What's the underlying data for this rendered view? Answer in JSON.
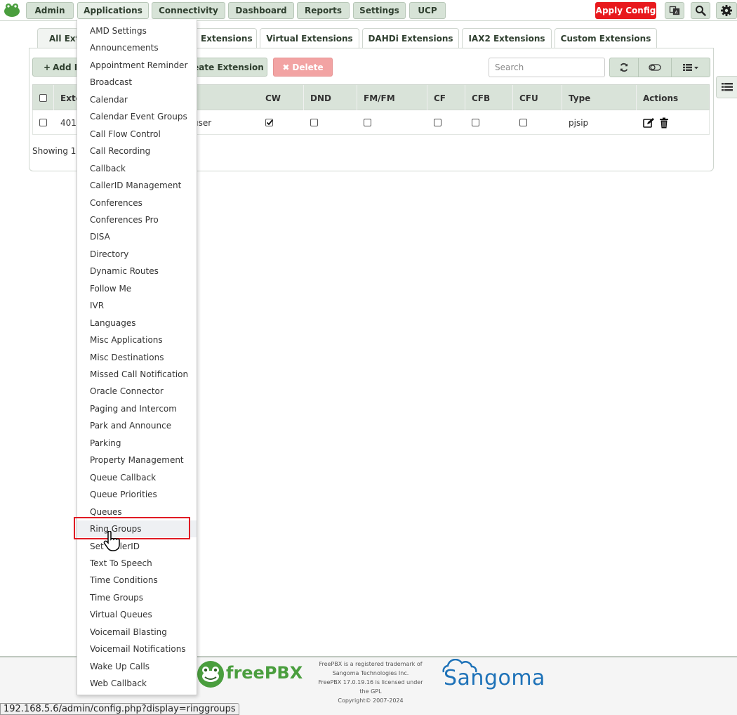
{
  "nav": {
    "items": [
      {
        "label": "Admin"
      },
      {
        "label": "Applications"
      },
      {
        "label": "Connectivity"
      },
      {
        "label": "Dashboard"
      },
      {
        "label": "Reports"
      },
      {
        "label": "Settings"
      },
      {
        "label": "UCP"
      }
    ],
    "apply_label": "Apply Config"
  },
  "tabs": [
    {
      "label": "All Exte"
    },
    {
      "label": "] Extensions"
    },
    {
      "label": "Virtual Extensions"
    },
    {
      "label": "DAHDi Extensions"
    },
    {
      "label": "IAX2 Extensions"
    },
    {
      "label": "Custom Extensions"
    }
  ],
  "toolbar": {
    "add_label": "Add E",
    "create_label": "eate Extension",
    "delete_label": "Delete",
    "search_placeholder": "Search"
  },
  "table": {
    "headers": [
      "Exte",
      "CW",
      "DND",
      "FM/FM",
      "CF",
      "CFB",
      "CFU",
      "Type",
      "Actions"
    ],
    "row": {
      "ext": "401",
      "name": "user",
      "type": "pjsip",
      "cw_checked": true
    },
    "showing": "Showing 1 t"
  },
  "dropdown": {
    "items": [
      "AMD Settings",
      "Announcements",
      "Appointment Reminder",
      "Broadcast",
      "Calendar",
      "Calendar Event Groups",
      "Call Flow Control",
      "Call Recording",
      "Callback",
      "CallerID Management",
      "Conferences",
      "Conferences Pro",
      "DISA",
      "Directory",
      "Dynamic Routes",
      "Follow Me",
      "IVR",
      "Languages",
      "Misc Applications",
      "Misc Destinations",
      "Missed Call Notification",
      "Oracle Connector",
      "Paging and Intercom",
      "Park and Announce",
      "Parking",
      "Property Management",
      "Queue Callback",
      "Queue Priorities",
      "Queues",
      "Ring Groups",
      "Set CallerID",
      "Text To Speech",
      "Time Conditions",
      "Time Groups",
      "Virtual Queues",
      "Voicemail Blasting",
      "Voicemail Notifications",
      "Wake Up Calls",
      "Web Callback"
    ],
    "hovered": "Ring Groups"
  },
  "footer": {
    "brand": "freePBX",
    "legal_1": "FreePBX is a registered trademark of",
    "legal_2": "Sangoma Technologies Inc.",
    "legal_3": "FreePBX 17.0.19.16 is licensed under",
    "legal_4": "the GPL",
    "legal_5": "Copyright© 2007-2024",
    "sangoma": "Sangoma"
  },
  "status_url": "192.168.5.6/admin/config.php?display=ringgroups",
  "colors": {
    "accent_green": "#d7e3d7",
    "apply_red": "#e8191d",
    "highlight": "#e01b24",
    "freepbx_green": "#4a9e3e",
    "sangoma_blue": "#1e72b8"
  }
}
